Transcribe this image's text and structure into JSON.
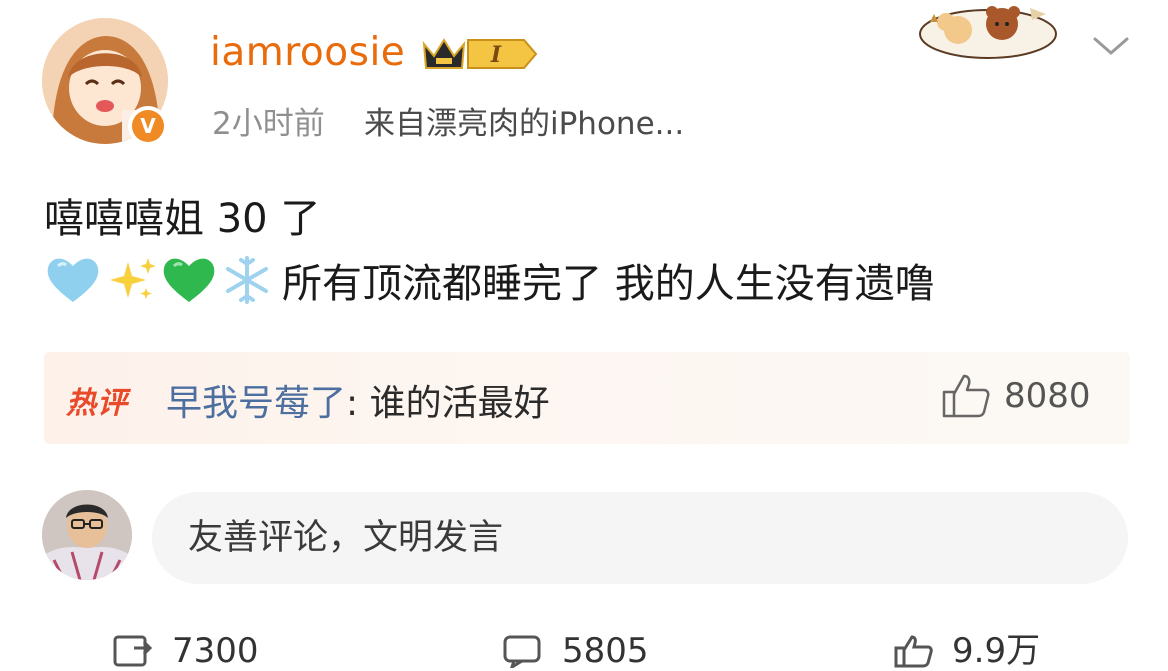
{
  "post": {
    "username": "iamroosie",
    "vip_level": "I",
    "time": "2小时前",
    "source": "来自漂亮肉的iPhone...",
    "text_line1": "嘻嘻嘻姐 30 了",
    "emojis": [
      "light-blue-heart",
      "sparkles",
      "green-heart",
      "snowflake"
    ],
    "text_line2": "所有顶流都睡完了 我的人生没有遗噜",
    "verified_badge": "V"
  },
  "hot_comment": {
    "label": "热评",
    "user": "早我号莓了",
    "separator": ": ",
    "text": "谁的活最好",
    "likes": "8080"
  },
  "comment_input": {
    "placeholder": "友善评论，文明发言"
  },
  "toolbar": {
    "repost_count": "7300",
    "comment_count": "5805",
    "like_count": "9.9万"
  },
  "colors": {
    "username": "#e86b0c",
    "hot_label": "#e84a2a",
    "hot_user": "#4c6fa0",
    "verified": "#f08a24"
  }
}
